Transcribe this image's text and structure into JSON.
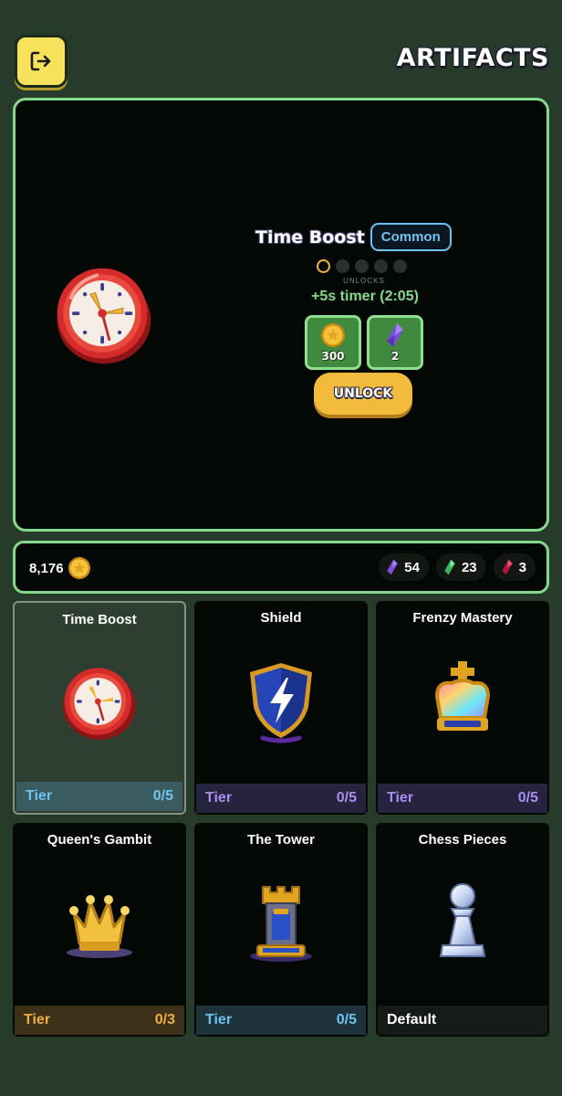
{
  "header": {
    "title": "ARTIFACTS",
    "exit_icon": "exit-icon"
  },
  "hero": {
    "name": "Time Boost",
    "rarity": "Common",
    "unlocks_label": "UNLOCKS",
    "unlocks_progress": {
      "filled": 1,
      "total": 5
    },
    "effect": "+5s timer (2:05)",
    "costs": [
      {
        "icon": "gold-coin-icon",
        "value": "300"
      },
      {
        "icon": "purple-gem-icon",
        "value": "2"
      }
    ],
    "unlock_label": "UNLOCK",
    "icon": "clock-icon"
  },
  "balance": {
    "coins": "8,176",
    "gems": [
      {
        "icon": "purple-gem-icon",
        "value": "54",
        "color": "#8b5cf6"
      },
      {
        "icon": "green-gem-icon",
        "value": "23",
        "color": "#4ade80"
      },
      {
        "icon": "red-gem-icon",
        "value": "3",
        "color": "#e11d48"
      }
    ]
  },
  "artifacts": [
    {
      "name": "Time Boost",
      "icon": "clock-icon",
      "tier_label": "Tier",
      "tier_value": "0/5",
      "selected": true
    },
    {
      "name": "Shield",
      "icon": "shield-icon",
      "tier_label": "Tier",
      "tier_value": "0/5"
    },
    {
      "name": "Frenzy Mastery",
      "icon": "crown-icon",
      "tier_label": "Tier",
      "tier_value": "0/5"
    },
    {
      "name": "Queen's Gambit",
      "icon": "queen-crown-icon",
      "tier_label": "Tier",
      "tier_value": "0/3"
    },
    {
      "name": "The Tower",
      "icon": "rook-tower-icon",
      "tier_label": "Tier",
      "tier_value": "0/5"
    },
    {
      "name": "Chess Pieces",
      "icon": "pawn-icon",
      "tier_label": "Default",
      "tier_value": ""
    }
  ],
  "colors": {
    "accent_green": "#86d98a",
    "common_blue": "#6fc3f2",
    "unlock_gold": "#f2bb3b",
    "exit_yellow": "#f7e25c"
  }
}
